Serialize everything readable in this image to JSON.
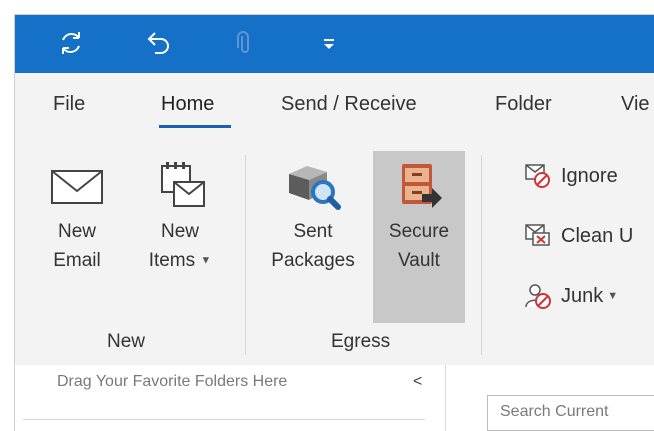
{
  "tabs": [
    {
      "label": "File"
    },
    {
      "label": "Home"
    },
    {
      "label": "Send / Receive"
    },
    {
      "label": "Folder"
    },
    {
      "label": "Vie"
    }
  ],
  "active_tab": "Home",
  "groups": {
    "new": {
      "label": "New",
      "new_email": {
        "line1": "New",
        "line2": "Email"
      },
      "new_items": {
        "line1": "New",
        "line2": "Items"
      }
    },
    "egress": {
      "label": "Egress",
      "sent_packages": {
        "line1": "Sent",
        "line2": "Packages"
      },
      "secure_vault": {
        "line1": "Secure",
        "line2": "Vault"
      }
    },
    "delete": {
      "ignore": "Ignore",
      "clean_up": "Clean U",
      "junk": "Junk"
    }
  },
  "folder_pane": {
    "favorites_hint": "Drag Your Favorite Folders Here",
    "collapse_glyph": "<"
  },
  "search": {
    "placeholder": "Search Current"
  },
  "colors": {
    "qat_bg": "#1570c7",
    "ribbon_bg": "#f3f3f3",
    "accent": "#1a5fb4",
    "selected_bg": "#c8c8c8"
  },
  "icons": [
    "sync-icon",
    "undo-icon",
    "attach-icon",
    "customize-dropdown-icon",
    "envelope-icon",
    "new-items-icon",
    "sent-packages-icon",
    "secure-vault-icon",
    "ignore-icon",
    "clean-up-icon",
    "junk-icon"
  ]
}
